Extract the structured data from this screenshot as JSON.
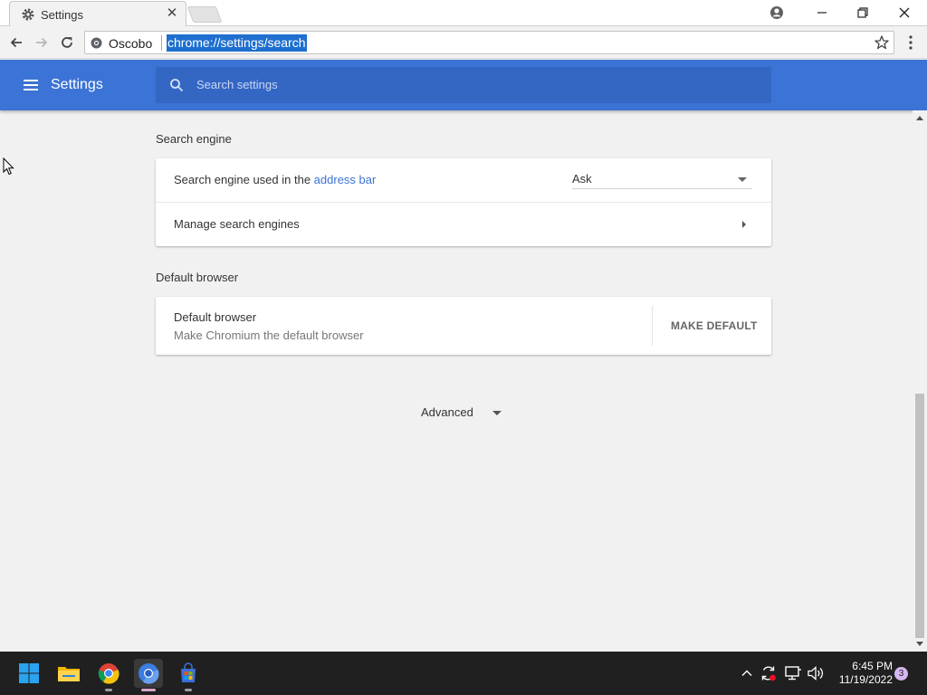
{
  "browser": {
    "tab": {
      "title": "Settings",
      "icon": "gear-icon",
      "close_glyph": "✕"
    },
    "window_controls": [
      "profile-icon",
      "minimize-icon",
      "restore-icon",
      "close-icon"
    ],
    "omnibox": {
      "site_name": "Oscobo",
      "url": "chrome://settings/search"
    }
  },
  "settings": {
    "header_title": "Settings",
    "search_placeholder": "Search settings",
    "sections": {
      "search_engine": {
        "title": "Search engine",
        "row1_prefix": "Search engine used in the ",
        "row1_link": "address bar",
        "row1_value": "Ask",
        "row2_label": "Manage search engines"
      },
      "default_browser": {
        "title": "Default browser",
        "label": "Default browser",
        "sublabel": "Make Chromium the default browser",
        "button": "MAKE DEFAULT"
      }
    },
    "advanced_label": "Advanced"
  },
  "taskbar": {
    "apps": [
      "start-icon",
      "file-explorer-icon",
      "chrome-icon",
      "chromium-icon",
      "store-icon"
    ],
    "time": "6:45 PM",
    "date": "11/19/2022",
    "notification_count": "3"
  },
  "colors": {
    "accent": "#3b73d6",
    "header_search": "#3466c4",
    "url_selection": "#1e6fcf",
    "taskbar": "#202020"
  }
}
